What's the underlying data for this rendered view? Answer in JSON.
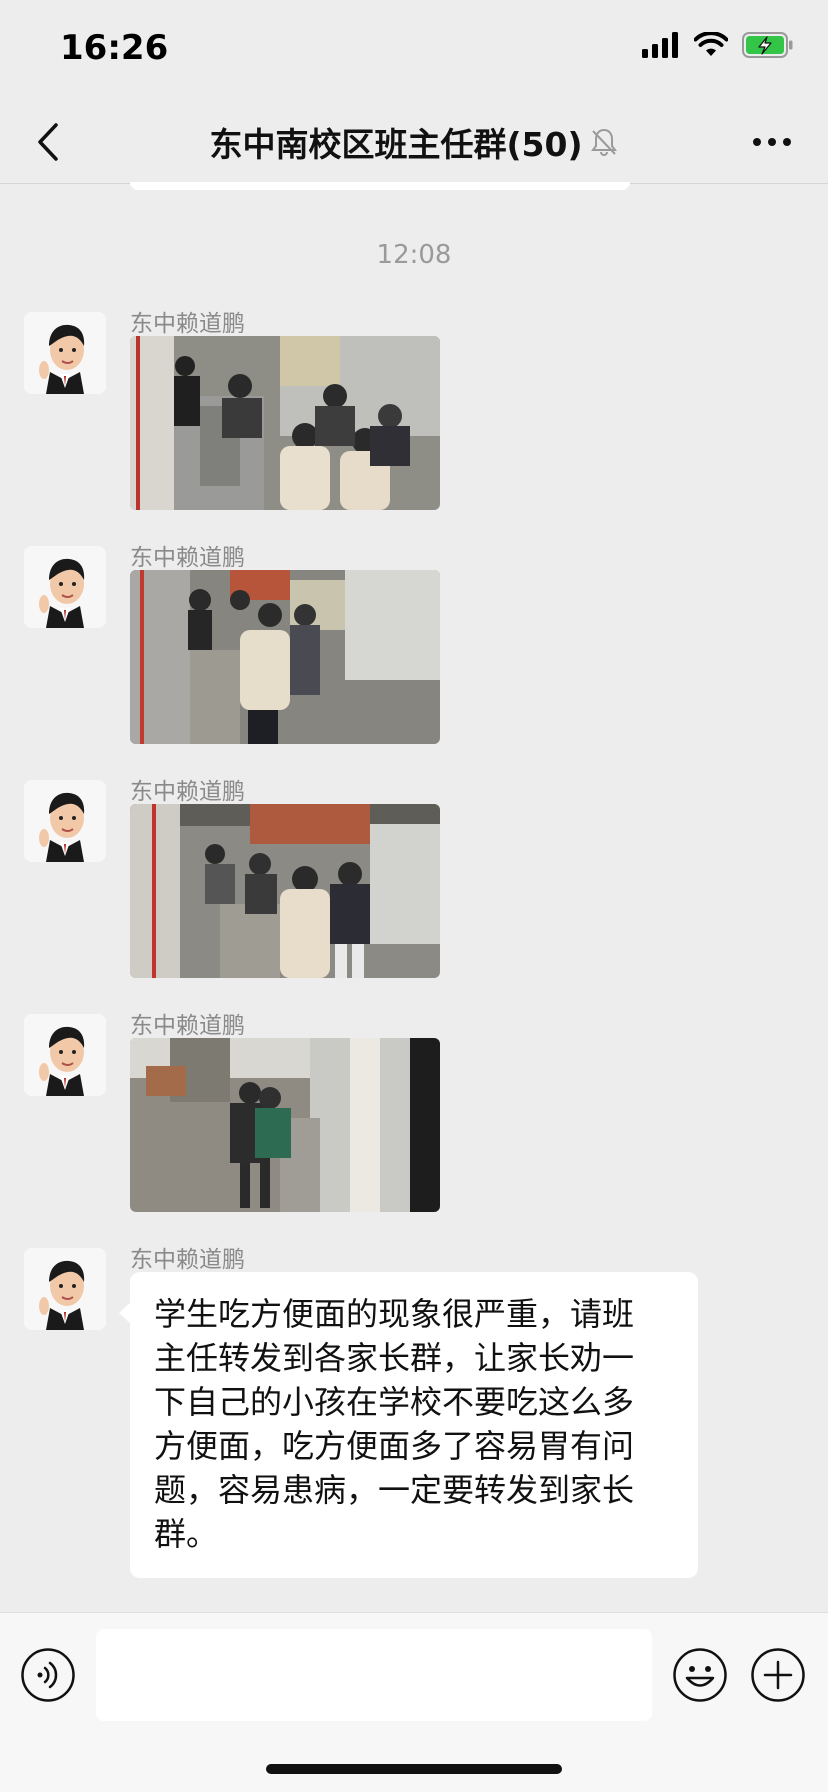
{
  "status_bar": {
    "time": "16:26",
    "icons": [
      "signal-icon",
      "wifi-icon",
      "battery-charging-icon"
    ]
  },
  "nav": {
    "title": "东中南校区班主任群(50)",
    "icons": [
      "back-icon",
      "mute-bell-icon",
      "more-icon"
    ]
  },
  "conversation": {
    "timestamp": "12:08",
    "messages": [
      {
        "sender": "东中赖道鹏",
        "kind": "image"
      },
      {
        "sender": "东中赖道鹏",
        "kind": "image"
      },
      {
        "sender": "东中赖道鹏",
        "kind": "image"
      },
      {
        "sender": "东中赖道鹏",
        "kind": "image"
      },
      {
        "sender": "东中赖道鹏",
        "kind": "text",
        "lines": [
          "学生吃方便面的现象很严重，请班",
          "主任转发到各家长群，让家长劝一",
          "下自己的小孩在学校不要吃这么多",
          "方便面，吃方便面多了容易胃有问",
          "题，容易患病，一定要转发到家长",
          "群。"
        ]
      }
    ]
  },
  "input_bar": {
    "text": "",
    "icons": [
      "voice-icon",
      "emoji-icon",
      "plus-icon"
    ]
  },
  "colors": {
    "background": "#ededed",
    "bubble": "#ffffff",
    "battery": "#33c548"
  }
}
